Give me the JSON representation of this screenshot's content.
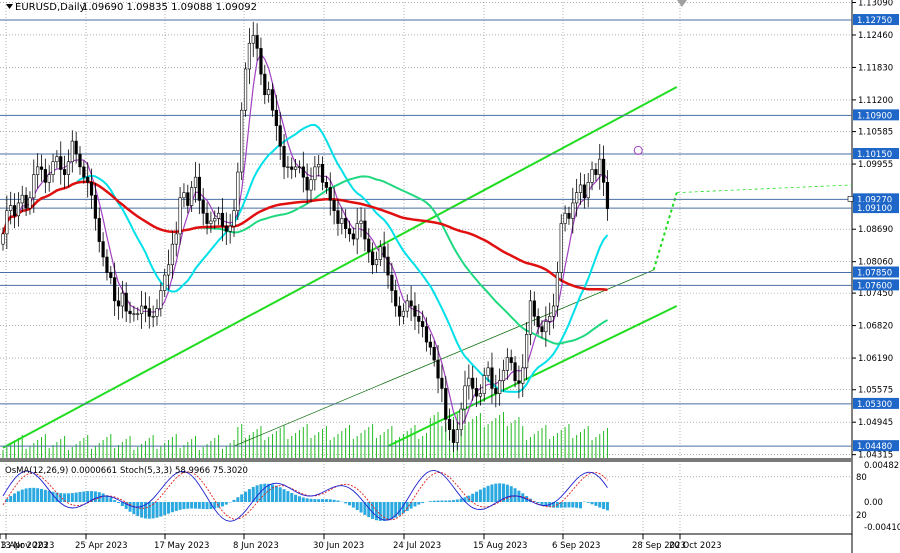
{
  "colors": {
    "background": "#ffffff",
    "grid": "#808080",
    "candle": "#000000",
    "ma_purple": "#a040c0",
    "ma_cyan": "#00e0e8",
    "ma_green": "#20d880",
    "ma_red": "#e01010",
    "channel": "#20dd20",
    "level_line": "#4a6fa5",
    "tag_bg": "#1e66c8",
    "tag_text": "#ffffff",
    "volume": "#22bb22",
    "osma_bar": "#2aa8e0",
    "stoch_main": "#2020d0",
    "stoch_signal": "#e02020"
  },
  "header": {
    "symbol_label": "EURUSD,Daily",
    "ohlc": "1.09690 1.09835 1.09088 1.09092"
  },
  "chart_data": {
    "type": "candlestick",
    "symbol": "EURUSD",
    "timeframe": "Daily",
    "ylim": [
      1.0425,
      1.131
    ],
    "y_ticks": [
      1.1309,
      1.1246,
      1.1183,
      1.112,
      1.10585,
      1.09955,
      1.0869,
      1.0806,
      1.0745,
      1.0682,
      1.0619,
      1.05575,
      1.04945,
      1.04315
    ],
    "y_tick_labels": [
      "1.13090",
      "1.12460",
      "1.11830",
      "1.11200",
      "1.10585",
      "1.09955",
      "1.08690",
      "1.08060",
      "1.07450",
      "1.06820",
      "1.06190",
      "1.05575",
      "1.04945",
      "1.04315"
    ],
    "x_labels": [
      "3 Apr 2023",
      "25 Apr 2023",
      "17 May 2023",
      "8 Jun 2023",
      "30 Jun 2023",
      "24 Jul 2023",
      "15 Aug 2023",
      "6 Sep 2023",
      "28 Sep 2023",
      "20 Oct 2023",
      "13 Nov 2023"
    ],
    "levels": [
      {
        "price": 1.1275,
        "label": "1.12750"
      },
      {
        "price": 1.109,
        "label": "1.10900"
      },
      {
        "price": 1.1015,
        "label": "1.10150"
      },
      {
        "price": 1.0927,
        "label": "1.09270"
      },
      {
        "price": 1.091,
        "label": "1.09100"
      },
      {
        "price": 1.0785,
        "label": "1.07850"
      },
      {
        "price": 1.076,
        "label": "1.07600"
      },
      {
        "price": 1.053,
        "label": "1.05300"
      },
      {
        "price": 1.0448,
        "label": "1.04480"
      }
    ],
    "closes": [
      1.086,
      1.0905,
      1.0915,
      1.0895,
      1.092,
      1.0935,
      1.091,
      1.093,
      1.0975,
      1.099,
      1.0985,
      1.096,
      1.0975,
      1.1,
      1.101,
      1.0985,
      1.0975,
      1.1,
      1.104,
      1.1015,
      1.099,
      1.097,
      1.096,
      1.0935,
      1.089,
      1.0845,
      1.0815,
      1.0785,
      1.0775,
      1.073,
      1.072,
      1.0745,
      1.071,
      1.0705,
      1.0705,
      1.0705,
      1.072,
      1.0715,
      1.07,
      1.07,
      1.0715,
      1.075,
      1.078,
      1.08,
      1.084,
      1.086,
      1.093,
      1.094,
      1.0915,
      1.095,
      1.097,
      1.0925,
      1.09,
      1.088,
      1.0885,
      1.089,
      1.09,
      1.0875,
      1.0865,
      1.0875,
      1.0905,
      1.098,
      1.11,
      1.118,
      1.123,
      1.1245,
      1.122,
      1.117,
      1.113,
      1.114,
      1.11,
      1.107,
      1.103,
      1.099,
      1.099,
      1.0985,
      1.099,
      1.099,
      1.097,
      1.0945,
      1.0965,
      1.099,
      1.0995,
      1.096,
      1.095,
      1.0925,
      1.0905,
      1.088,
      1.089,
      1.087,
      1.086,
      1.085,
      1.088,
      1.0885,
      1.085,
      1.0825,
      1.08,
      1.081,
      1.0835,
      1.0815,
      1.078,
      1.075,
      1.072,
      1.07,
      1.071,
      1.073,
      1.072,
      1.07,
      1.069,
      1.068,
      1.065,
      1.064,
      1.0615,
      1.058,
      1.056,
      1.05,
      1.048,
      1.0455,
      1.048,
      1.052,
      1.0565,
      1.058,
      1.056,
      1.0545,
      1.055,
      1.0585,
      1.06,
      1.056,
      1.055,
      1.0575,
      1.0595,
      1.062,
      1.061,
      1.0575,
      1.057,
      1.06,
      1.0665,
      1.073,
      1.07,
      1.068,
      1.067,
      1.069,
      1.07,
      1.072,
      1.0785,
      1.088,
      1.09,
      1.089,
      1.092,
      1.094,
      1.0955,
      1.093,
      1.096,
      1.0985,
      1.0975,
      1.1005,
      1.096,
      1.0909
    ],
    "channel_lines": [
      {
        "from_index": 0,
        "from_price": 1.0445,
        "to_index": 175,
        "to_price": 1.1145
      },
      {
        "from_index": 100,
        "from_price": 1.0448,
        "to_index": 175,
        "to_price": 1.072
      },
      {
        "from_index": 60,
        "from_price": 1.0448,
        "to_index": 169,
        "to_price": 1.079
      },
      {
        "from_index": 169,
        "from_price": 1.079,
        "to_index": 175,
        "to_price": 1.094
      }
    ],
    "osma": {
      "label": "OsMA(12,26,9) 0.0000661",
      "ylim": [
        -0.0041,
        0.004827
      ],
      "tick_labels": [
        "0.004827",
        "0.00",
        "-0.004100"
      ]
    },
    "stochastic": {
      "label": "Stoch(5,3,3) 58.9966 75.3020",
      "levels": [
        80,
        20
      ],
      "tick_labels": [
        "80",
        "20"
      ]
    }
  }
}
